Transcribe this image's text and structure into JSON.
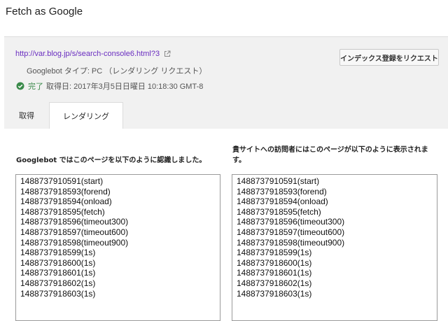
{
  "page": {
    "title": "Fetch as Google"
  },
  "result": {
    "url": "http://var.blog.jp/s/search-console6.html?3",
    "agent": "Googlebot タイプ: PC （レンダリング リクエスト）",
    "status_label": "完了",
    "fetched_at": "取得日: 2017年3月5日日曜日 10:18:30 GMT-8",
    "index_button": "インデックス登録をリクエスト"
  },
  "tabs": [
    {
      "label": "取得",
      "active": false
    },
    {
      "label": "レンダリング",
      "active": true
    }
  ],
  "render": {
    "googlebot_label": "Googlebot ではこのページを以下のように認識しました。",
    "visitor_label": "貴サイトへの訪問者にはこのページが以下のように表示されます。",
    "googlebot_lines": [
      "1488737910591(start)",
      "1488737918593(forend)",
      "1488737918594(onload)",
      "1488737918595(fetch)",
      "1488737918596(timeout300)",
      "1488737918597(timeout600)",
      "1488737918598(timeout900)",
      "1488737918599(1s)",
      "1488737918600(1s)",
      "1488737918601(1s)",
      "1488737918602(1s)",
      "1488737918603(1s)"
    ],
    "visitor_lines": [
      "1488737910591(start)",
      "1488737918593(forend)",
      "1488737918594(onload)",
      "1488737918595(fetch)",
      "1488737918596(timeout300)",
      "1488737918597(timeout600)",
      "1488737918598(timeout900)",
      "1488737918599(1s)",
      "1488737918600(1s)",
      "1488737918601(1s)",
      "1488737918602(1s)",
      "1488737918603(1s)"
    ]
  },
  "icons": {
    "external": "external-link-icon",
    "status": "check-circle-icon"
  },
  "colors": {
    "link": "#6a2ec0",
    "success": "#3a8a4a",
    "panel_bg": "#f1f1f1"
  }
}
